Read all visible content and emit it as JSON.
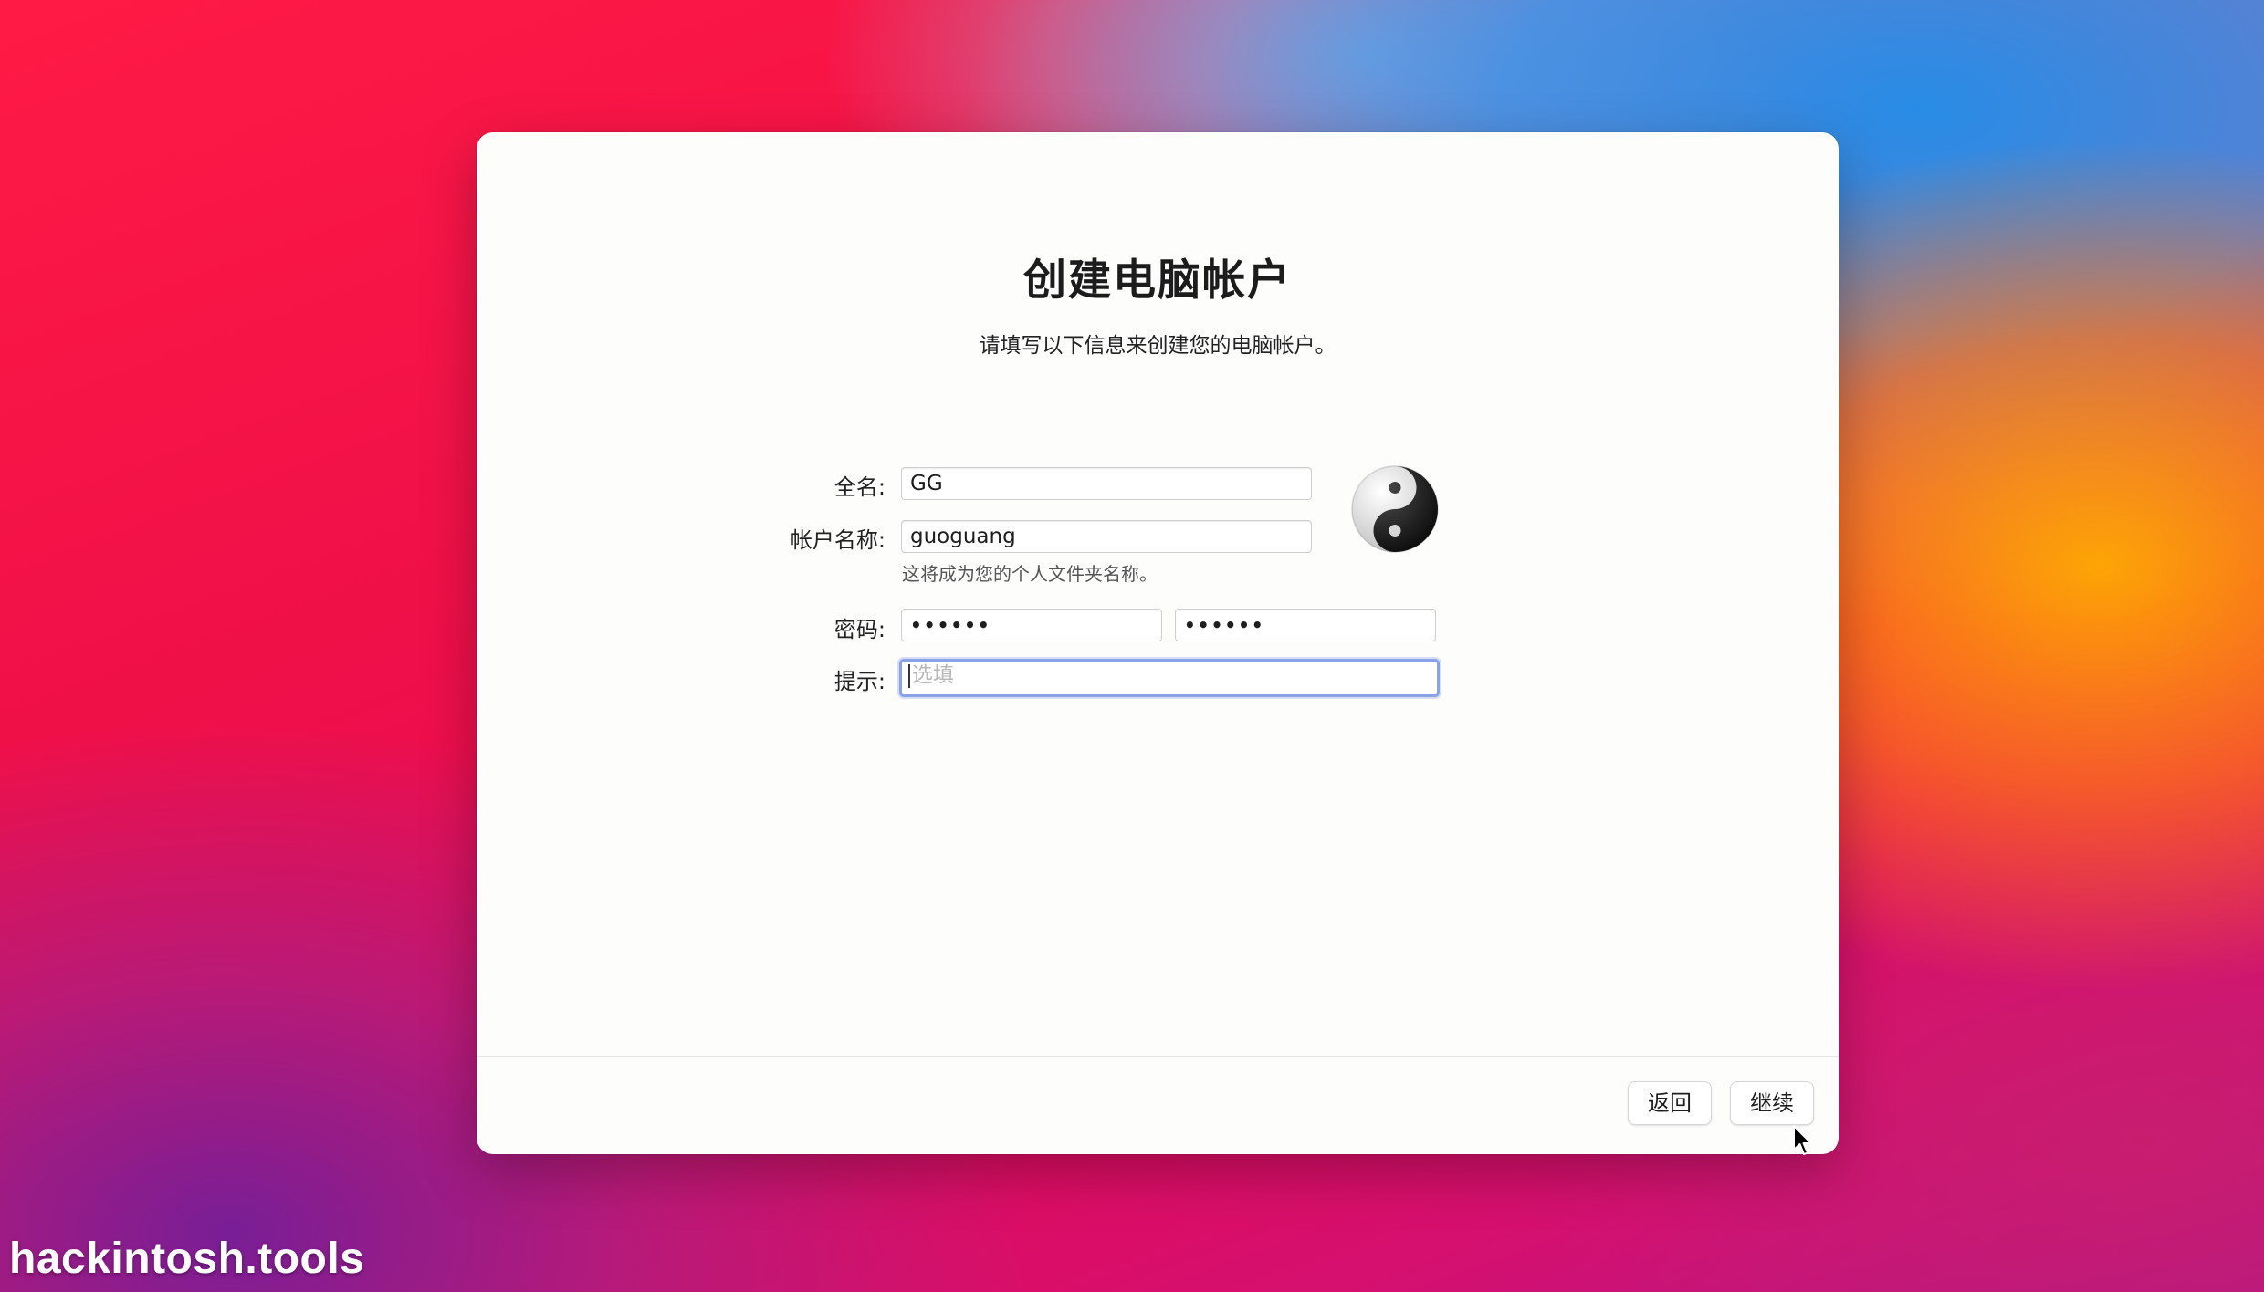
{
  "dialog": {
    "title": "创建电脑帐户",
    "subtitle": "请填写以下信息来创建您的电脑帐户。"
  },
  "form": {
    "full_name": {
      "label": "全名:",
      "value": "GG"
    },
    "account_name": {
      "label": "帐户名称:",
      "value": "guoguang",
      "helper": "这将成为您的个人文件夹名称。"
    },
    "password": {
      "label": "密码:",
      "value": "••••••",
      "verify_value": "••••••"
    },
    "hint": {
      "label": "提示:",
      "placeholder": "选填",
      "value": ""
    }
  },
  "avatar": {
    "icon": "yin-yang-icon"
  },
  "buttons": {
    "back": "返回",
    "continue": "继续"
  },
  "watermark": "hackintosh.tools",
  "colors": {
    "focus_ring": "#8aa3e8",
    "window_bg": "#fdfdfc"
  }
}
